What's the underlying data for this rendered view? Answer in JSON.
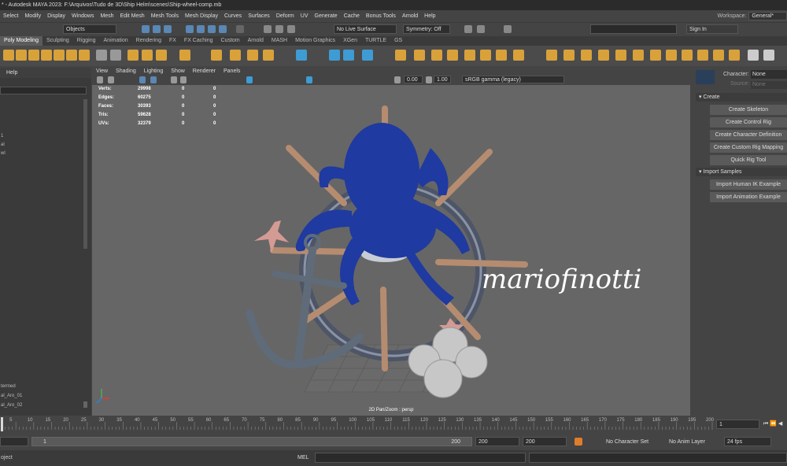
{
  "title": "* - Autodesk MAYA 2023: F:\\Arquivos\\Tudo de 3D\\Ship Helm\\scenes\\Ship-wheel-comp.mb",
  "menu": [
    "Select",
    "Modify",
    "Display",
    "Windows",
    "Mesh",
    "Edit Mesh",
    "Mesh Tools",
    "Mesh Display",
    "Curves",
    "Surfaces",
    "Deform",
    "UV",
    "Generate",
    "Cache",
    "Bonus Tools",
    "Arnold",
    "Help"
  ],
  "workspace": {
    "label": "Workspace:",
    "value": "General*"
  },
  "status": {
    "objects": "Objects",
    "live_surface": "No Live Surface",
    "symmetry": "Symmetry: Off",
    "sign_in": "Sign In"
  },
  "shelf_tabs": [
    "Poly Modeling",
    "Sculpting",
    "Rigging",
    "Animation",
    "Rendering",
    "FX",
    "FX Caching",
    "Custom",
    "Arnold",
    "MASH",
    "Motion Graphics",
    "XGen",
    "TURTLE",
    "GS"
  ],
  "outliner": {
    "header": "Help",
    "items": [
      "termed",
      "al_Aro_01",
      "al_Aro_02"
    ],
    "marks": [
      "1",
      "al",
      "wl"
    ]
  },
  "viewport": {
    "menu": [
      "View",
      "Shading",
      "Lighting",
      "Show",
      "Renderer",
      "Panels"
    ],
    "exposure": "0.00",
    "gamma": "1.00",
    "colorspace": "sRGB gamma (legacy)",
    "stats": [
      {
        "label": "Verts:",
        "v1": "29998",
        "v2": "0",
        "v3": "0"
      },
      {
        "label": "Edges:",
        "v1": "60275",
        "v2": "0",
        "v3": "0"
      },
      {
        "label": "Faces:",
        "v1": "30393",
        "v2": "0",
        "v3": "0"
      },
      {
        "label": "Tris:",
        "v1": "59628",
        "v2": "0",
        "v3": "0"
      },
      {
        "label": "UVs:",
        "v1": "32379",
        "v2": "0",
        "v3": "0"
      }
    ],
    "hud": "2D Pan/Zoom : persp",
    "signature": "mariofinotti"
  },
  "character_panel": {
    "character_label": "Character:",
    "character_value": "None",
    "source_label": "Source:",
    "source_value": "None",
    "create_section": "Create",
    "create_buttons": [
      "Create Skeleton",
      "Create Control Rig",
      "Create Character Definition",
      "Create Custom Rig Mapping",
      "Quick Rig Tool"
    ],
    "import_section": "Import Samples",
    "import_buttons": [
      "Import Human IK Example",
      "Import Animation Example"
    ]
  },
  "timeline": {
    "ticks": [
      "5",
      "10",
      "15",
      "20",
      "25",
      "30",
      "35",
      "40",
      "45",
      "50",
      "55",
      "60",
      "65",
      "70",
      "75",
      "80",
      "85",
      "90",
      "95",
      "100",
      "105",
      "110",
      "115",
      "120",
      "125",
      "130",
      "135",
      "140",
      "145",
      "150",
      "155",
      "160",
      "165",
      "170",
      "175",
      "180",
      "185",
      "190",
      "195",
      "200"
    ],
    "current_frame": "1"
  },
  "range": {
    "start": "1",
    "inner_start": "1",
    "inner_end": "200",
    "end1": "200",
    "end2": "200",
    "char_set": "No Character Set",
    "anim_layer": "No Anim Layer",
    "fps": "24 fps"
  },
  "command": {
    "left": "oject",
    "mel": "MEL"
  }
}
